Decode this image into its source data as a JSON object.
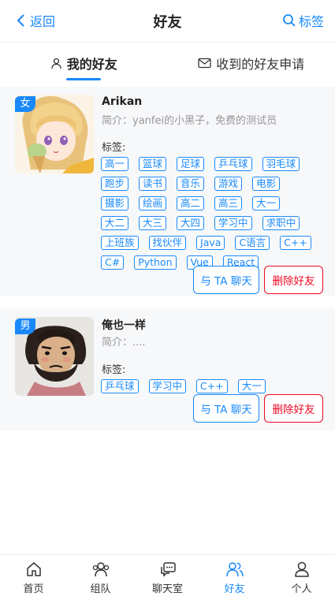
{
  "header": {
    "back_label": "返回",
    "title": "好友",
    "tag_label": "标签"
  },
  "tabs": [
    {
      "label": "我的好友",
      "active": true
    },
    {
      "label": "收到的好友申请",
      "active": false
    }
  ],
  "friends": [
    {
      "gender": "女",
      "name": "Arikan",
      "bio": "简介：yanfei的小黑子，免费的测试员",
      "tags_label": "标签:",
      "tags": [
        "高一",
        "篮球",
        "足球",
        "乒乓球",
        "羽毛球",
        "跑步",
        "读书",
        "音乐",
        "游戏",
        "电影",
        "摄影",
        "绘画",
        "高二",
        "高三",
        "大一",
        "大二",
        "大三",
        "大四",
        "学习中",
        "求职中",
        "上班族",
        "找伙伴",
        "Java",
        "C语言",
        "C++",
        "C#",
        "Python",
        "Vue",
        "React"
      ],
      "chat_label": "与 TA 聊天",
      "delete_label": "删除好友"
    },
    {
      "gender": "男",
      "name": "俺也一样",
      "bio": "简介：....",
      "tags_label": "标签:",
      "tags": [
        "乒乓球",
        "学习中",
        "C++",
        "大一"
      ],
      "chat_label": "与 TA 聊天",
      "delete_label": "删除好友"
    }
  ],
  "tabbar": [
    {
      "label": "首页",
      "icon": "home-icon",
      "active": false
    },
    {
      "label": "组队",
      "icon": "team-icon",
      "active": false
    },
    {
      "label": "聊天室",
      "icon": "chat-room-icon",
      "active": false
    },
    {
      "label": "好友",
      "icon": "friends-icon",
      "active": true
    },
    {
      "label": "个人",
      "icon": "user-icon",
      "active": false
    }
  ],
  "colors": {
    "accent": "#1989fa",
    "danger": "#ee0a24",
    "card_bg": "#f7f8fa"
  }
}
